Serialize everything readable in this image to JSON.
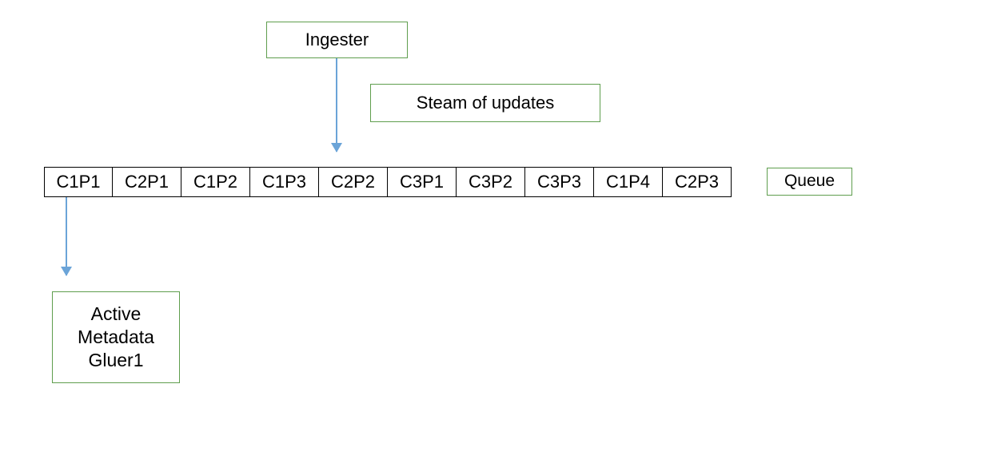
{
  "ingester": {
    "label": "Ingester"
  },
  "stream": {
    "label": "Steam of updates"
  },
  "queue_label": {
    "text": "Queue"
  },
  "gluer": {
    "line1": "Active",
    "line2": "Metadata",
    "line3": "Gluer1"
  },
  "queue": {
    "cells": [
      "C1P1",
      "C2P1",
      "C1P2",
      "C1P3",
      "C2P2",
      "C3P1",
      "C3P2",
      "C3P3",
      "C1P4",
      "C2P3"
    ]
  }
}
